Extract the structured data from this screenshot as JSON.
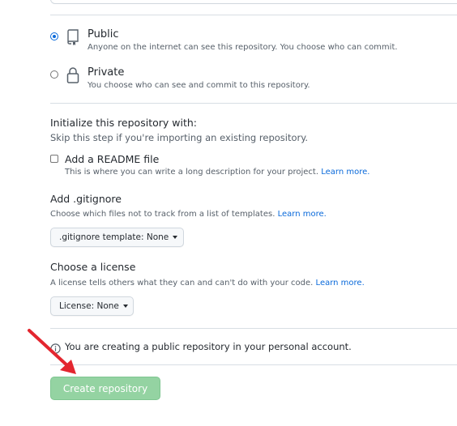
{
  "visibility": {
    "public": {
      "label": "Public",
      "description": "Anyone on the internet can see this repository. You choose who can commit.",
      "selected": true
    },
    "private": {
      "label": "Private",
      "description": "You choose who can see and commit to this repository.",
      "selected": false
    }
  },
  "initialize": {
    "title": "Initialize this repository with:",
    "subtitle": "Skip this step if you're importing an existing repository.",
    "readme": {
      "label": "Add a README file",
      "description": "This is where you can write a long description for your project.",
      "link": "Learn more.",
      "checked": false
    }
  },
  "gitignore": {
    "title": "Add .gitignore",
    "description": "Choose which files not to track from a list of templates.",
    "link": "Learn more.",
    "dropdown_label": ".gitignore template: None"
  },
  "license": {
    "title": "Choose a license",
    "description": "A license tells others what they can and can't do with your code.",
    "link": "Learn more.",
    "dropdown_label": "License: None"
  },
  "notice": {
    "text": "You are creating a public repository in your personal account."
  },
  "actions": {
    "create_label": "Create repository"
  },
  "colors": {
    "accent": "#0969da",
    "button_disabled": "#94d3a2",
    "annotation_arrow": "#e3262f"
  },
  "icons": {
    "public": "repo-icon",
    "private": "lock-icon",
    "info": "info-icon",
    "arrow": "red-arrow-annotation"
  }
}
